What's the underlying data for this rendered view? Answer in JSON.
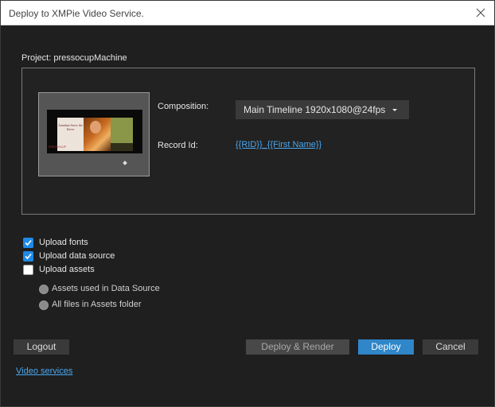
{
  "window": {
    "title": "Deploy to XMPie Video Service.",
    "close_icon": "close-icon"
  },
  "project": {
    "label": "Project: pressocupMachine"
  },
  "thumbnail": {
    "card_text": "Jonathan Savor the flavor",
    "logo_text": "PRESSOCUP"
  },
  "composition": {
    "label": "Composition:",
    "selected": "Main Timeline 1920x1080@24fps"
  },
  "record": {
    "label": "Record Id:",
    "value": "{{RID}}_{{First Name}}"
  },
  "options": {
    "upload_fonts": {
      "label": "Upload fonts",
      "checked": true
    },
    "upload_data_source": {
      "label": "Upload data source",
      "checked": true
    },
    "upload_assets": {
      "label": "Upload assets",
      "checked": false
    },
    "assets_used": {
      "label": "Assets used in Data Source"
    },
    "all_files": {
      "label": "All files in Assets folder"
    }
  },
  "buttons": {
    "logout": "Logout",
    "deploy_render": "Deploy & Render",
    "deploy": "Deploy",
    "cancel": "Cancel"
  },
  "footer": {
    "video_services": "Video services"
  },
  "colors": {
    "accent": "#2f86c9",
    "link": "#4aa8f0",
    "background": "#1f1f1f"
  }
}
